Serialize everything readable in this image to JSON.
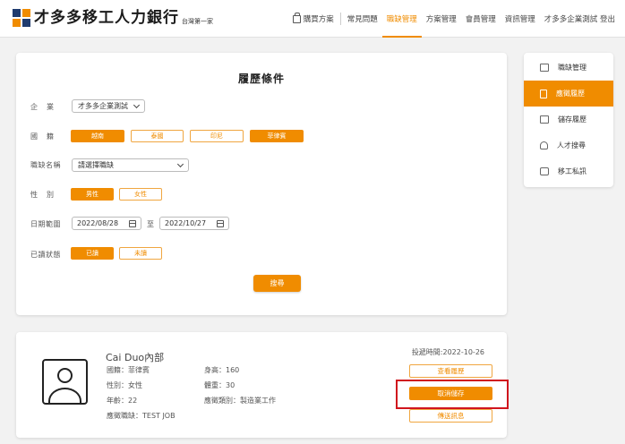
{
  "header": {
    "logo_text": "才多多移工人力銀行",
    "logo_sub": "台灣第一家",
    "nav": [
      "購買方案",
      "常見問題",
      "職缺管理",
      "方案管理",
      "會員管理",
      "資訊管理",
      "才多多企業測試 登出"
    ],
    "nav_active_index": 2
  },
  "search": {
    "title": "履歷條件",
    "company_label": "企業",
    "company_value": "才多多企業測試",
    "country_label": "國籍",
    "countries": [
      {
        "label": "越南",
        "selected": true
      },
      {
        "label": "泰國",
        "selected": false
      },
      {
        "label": "印尼",
        "selected": false
      },
      {
        "label": "菲律賓",
        "selected": true
      }
    ],
    "job_label": "職缺名稱",
    "job_value": "請選擇職缺",
    "gender_label": "性別",
    "genders": [
      {
        "label": "男性",
        "selected": true
      },
      {
        "label": "女性",
        "selected": false
      }
    ],
    "date_label": "日期範圍",
    "date_from": "2022/08/28",
    "date_to_label": "至",
    "date_to": "2022/10/27",
    "read_label": "已讀狀態",
    "read_states": [
      {
        "label": "已讀",
        "selected": true
      },
      {
        "label": "未讀",
        "selected": false
      }
    ],
    "search_button": "搜尋"
  },
  "sidebar": {
    "items": [
      {
        "label": "職缺管理",
        "icon": "briefcase-icon",
        "active": false
      },
      {
        "label": "應徵履歷",
        "icon": "document-icon",
        "active": true
      },
      {
        "label": "儲存履歷",
        "icon": "folder-icon",
        "active": false
      },
      {
        "label": "人才搜尋",
        "icon": "user-search-icon",
        "active": false
      },
      {
        "label": "移工私訊",
        "icon": "message-icon",
        "active": false
      }
    ]
  },
  "result": {
    "name": "Cai Duo內部",
    "post_time": "投遞時間:2022-10-26",
    "nationality": "國籍：菲律賓",
    "gender": "性別：女性",
    "age": "年齡：22",
    "applied_job": "應徵職缺：TEST JOB",
    "height": "身高：160",
    "weight": "體重：30",
    "job_category": "應徵類別：製造業工作",
    "buttons": {
      "view": "查看履歷",
      "unsave": "取消儲存",
      "message": "傳送訊息"
    }
  },
  "colors": {
    "accent": "#f08c00",
    "highlight": "#d0151d",
    "logo_navy": "#1f3b6e"
  }
}
